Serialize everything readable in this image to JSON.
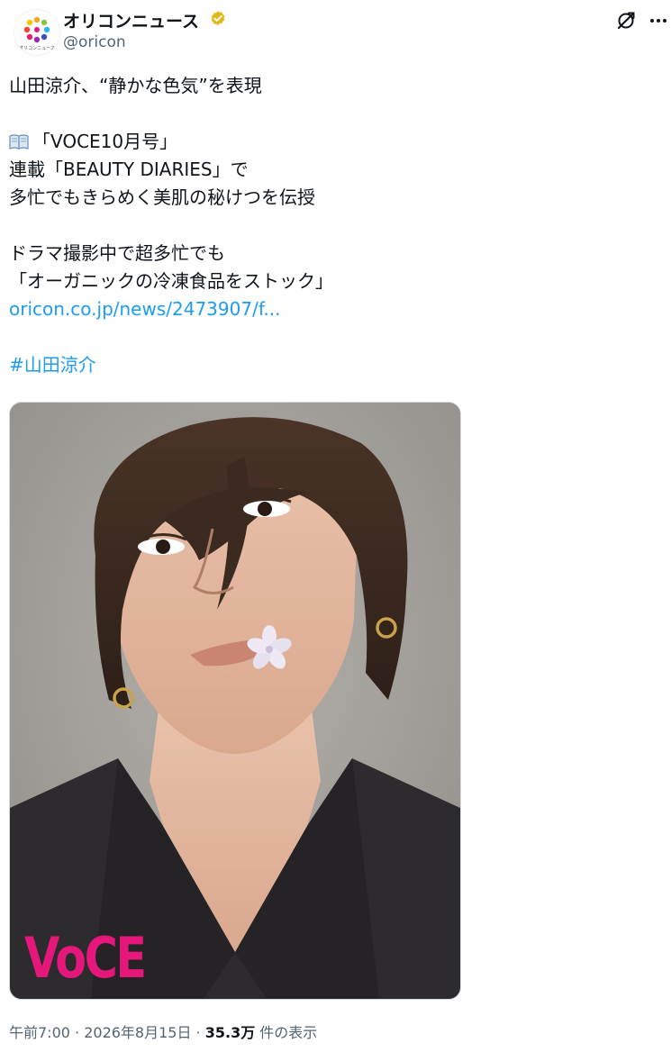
{
  "account": {
    "display_name": "オリコンニュース",
    "handle": "@oricon",
    "avatar_text": "オリコンニュース",
    "verified_color": "#e2b719"
  },
  "tweet": {
    "line1": "山田涼介、“静かな色気”を表現",
    "line2": "「VOCE10月号」",
    "line3": "連載「BEAUTY DIARIES」で",
    "line4": "多忙でもきらめく美肌の秘けつを伝授",
    "line5": "ドラマ撮影中で超多忙でも",
    "line6": "「オーガニックの冷凍食品をストック」",
    "link": "oricon.co.jp/news/2473907/f...",
    "hashtag": "#山田涼介"
  },
  "media": {
    "magazine_logo": "VoCE"
  },
  "meta": {
    "time": "午前7:00",
    "sep1": " · ",
    "date": "2026年8月15日",
    "sep2": " · ",
    "views": "35.3万",
    "views_suffix": " 件の表示"
  },
  "icons": {
    "verified": "verified-badge-icon",
    "grok": "grok-icon",
    "more": "more-icon",
    "book": "open-book-icon"
  },
  "colors": {
    "link": "#1d9bf0",
    "secondary_text": "#536471",
    "voce_pink": "#e5177b"
  }
}
